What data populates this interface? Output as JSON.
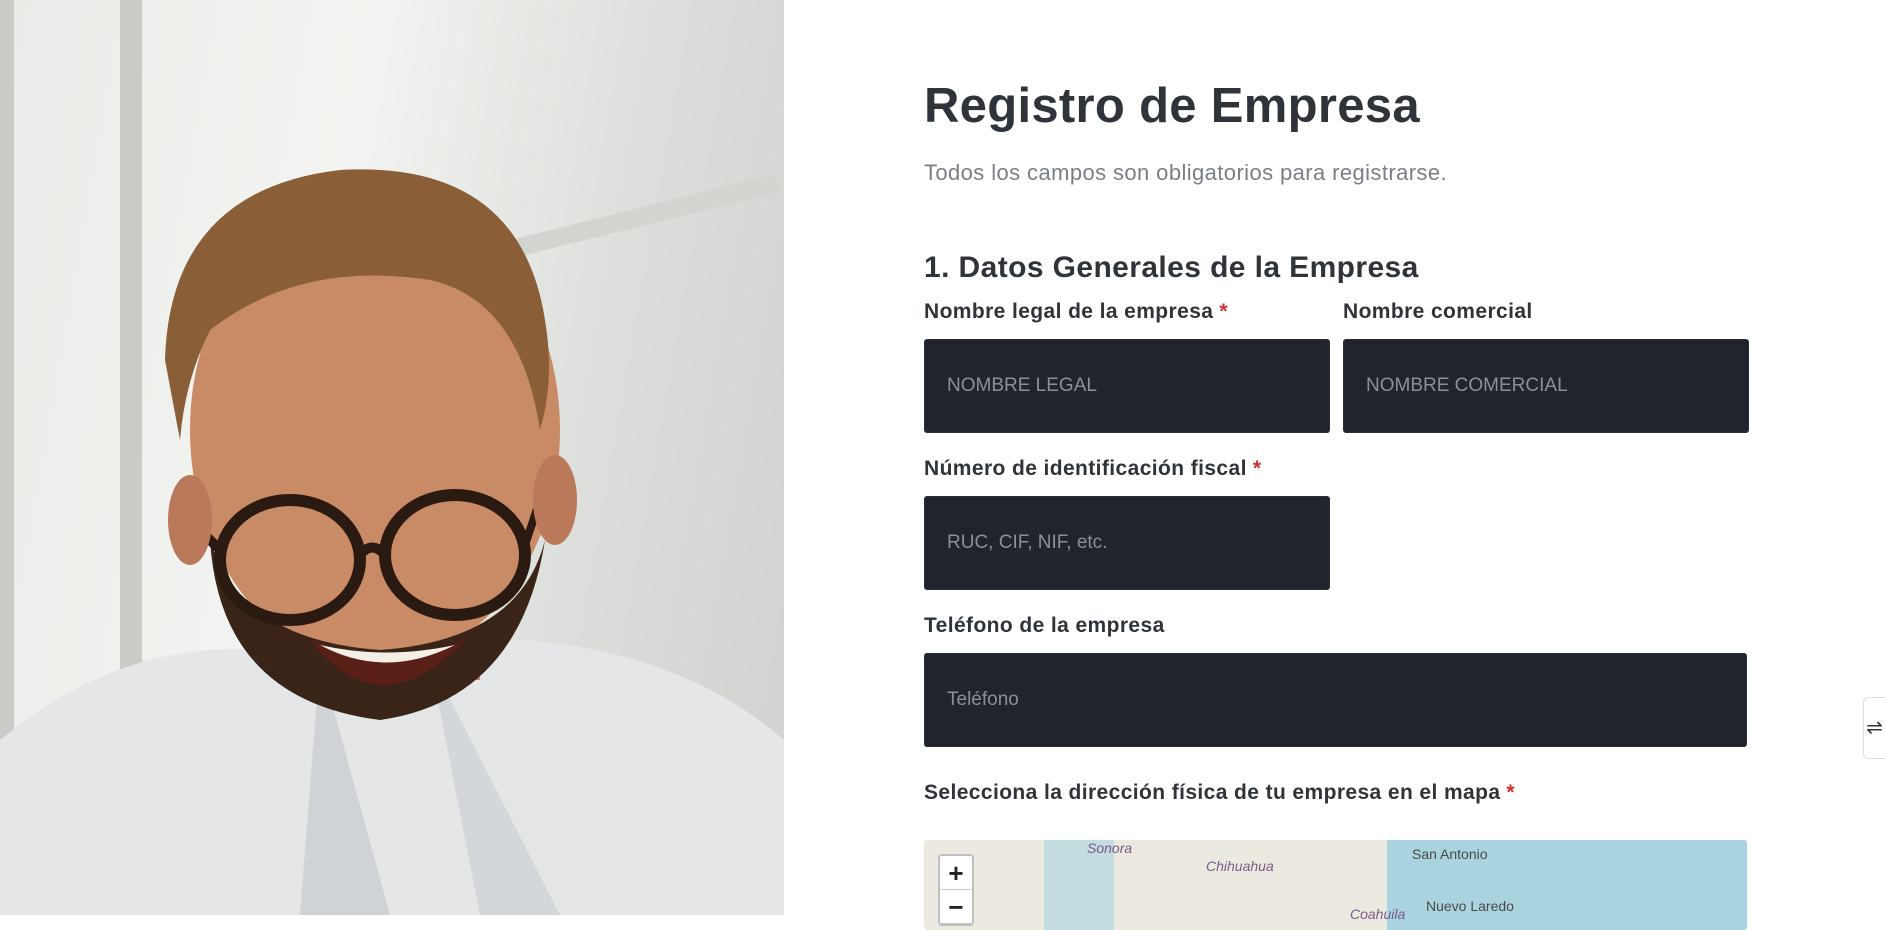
{
  "form": {
    "title": "Registro de Empresa",
    "subtitle": "Todos los campos son obligatorios para registrarse.",
    "section_title": "1. Datos Generales de la Empresa",
    "required_mark": "*",
    "fields": {
      "legal_name": {
        "label": "Nombre legal de la empresa",
        "placeholder": "NOMBRE LEGAL",
        "value": ""
      },
      "trade_name": {
        "label": "Nombre comercial",
        "placeholder": "NOMBRE COMERCIAL",
        "value": ""
      },
      "tax_id": {
        "label": "Número de identificación fiscal",
        "placeholder": "RUC, CIF, NIF, etc.",
        "value": ""
      },
      "phone": {
        "label": "Teléfono de la empresa",
        "placeholder": "Teléfono",
        "value": ""
      }
    },
    "map_label": "Selecciona la dirección física de tu empresa en el mapa"
  },
  "map": {
    "zoom_in": "+",
    "zoom_out": "−",
    "places": [
      "Sonora",
      "Chihuahua",
      "San Antonio",
      "Nuevo Laredo",
      "Coahuila"
    ]
  },
  "side_tab": {
    "icon": "handle-icon",
    "glyph": "⇌"
  },
  "colors": {
    "input_bg": "#20242c",
    "required": "#d32f2f",
    "title": "#2f343a"
  }
}
